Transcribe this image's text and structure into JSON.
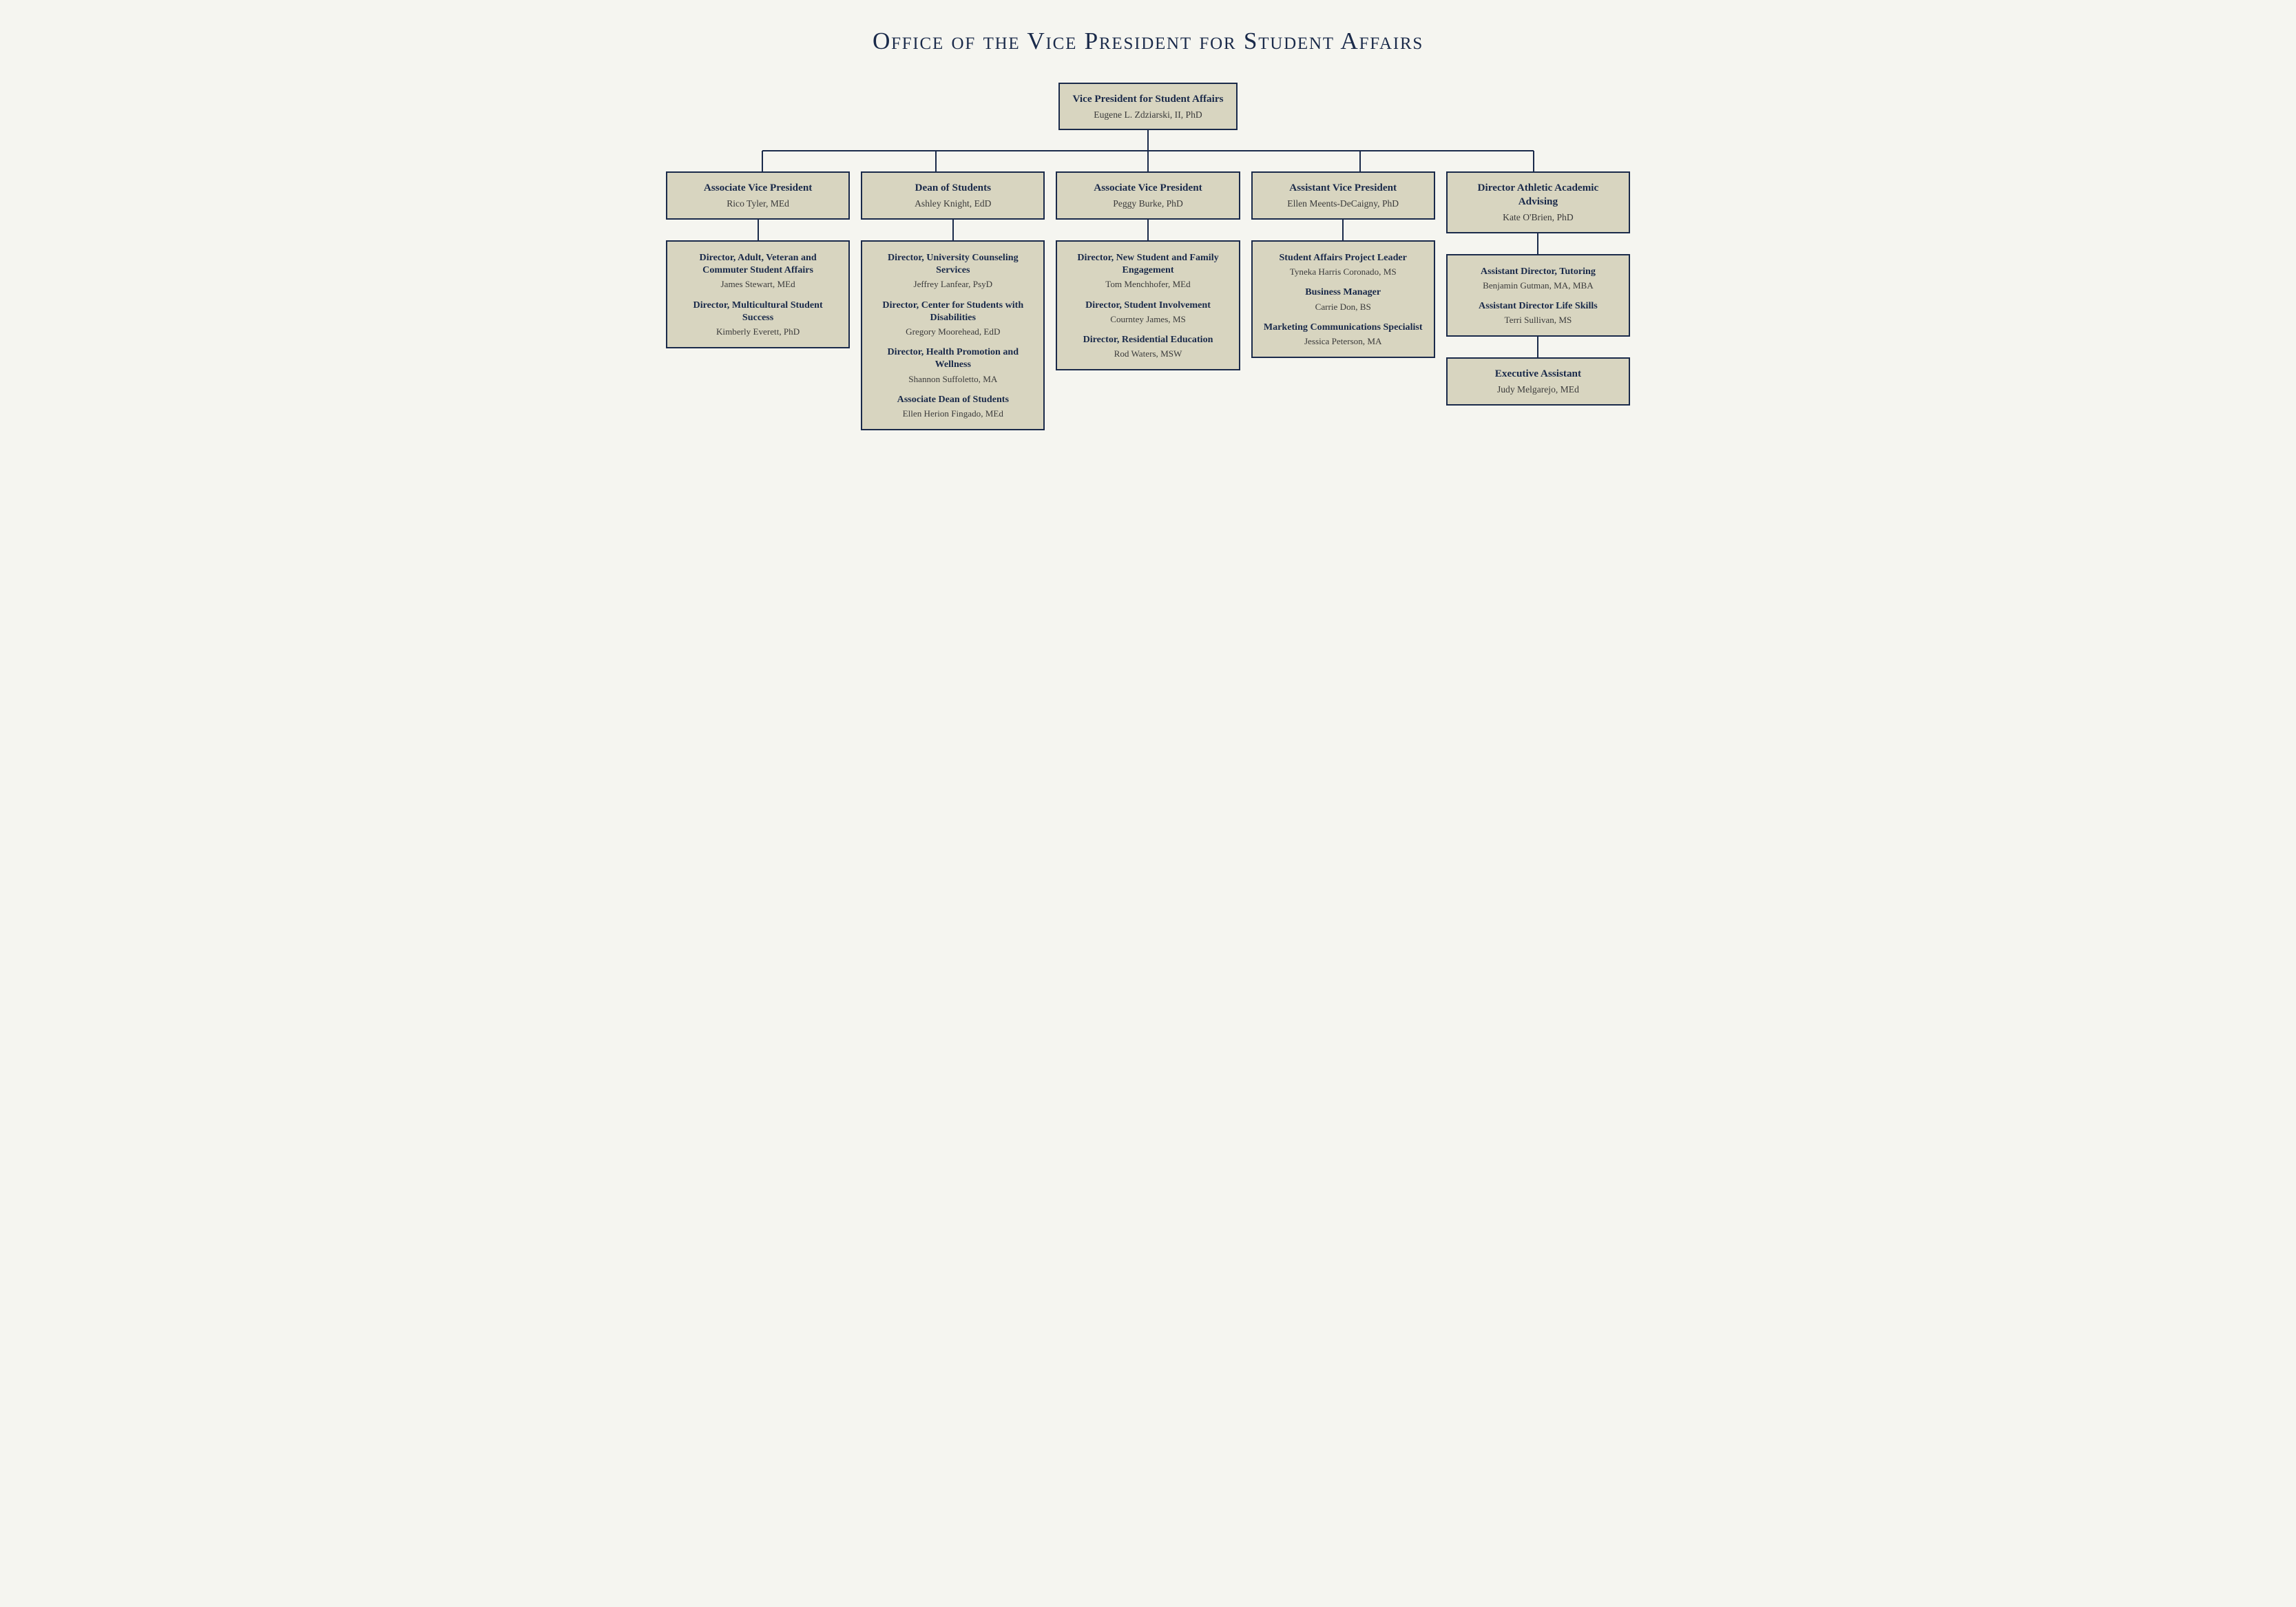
{
  "page": {
    "title": "Office of the Vice President for Student Affairs"
  },
  "vp": {
    "title": "Vice President for Student Affairs",
    "name": "Eugene L. Zdziarski, II, PhD"
  },
  "columns": [
    {
      "id": "col1",
      "level1": {
        "title": "Associate Vice President",
        "name": "Rico Tyler, MEd"
      },
      "level2": {
        "entries": [
          {
            "title": "Director, Adult, Veteran and Commuter Student Affairs",
            "name": "James Stewart, MEd"
          },
          {
            "title": "Director, Multicultural Student Success",
            "name": "Kimberly Everett, PhD"
          }
        ]
      }
    },
    {
      "id": "col2",
      "level1": {
        "title": "Dean of Students",
        "name": "Ashley Knight, EdD"
      },
      "level2": {
        "entries": [
          {
            "title": "Director, University Counseling Services",
            "name": "Jeffrey Lanfear, PsyD"
          },
          {
            "title": "Director, Center for Students with Disabilities",
            "name": "Gregory Moorehead, EdD"
          },
          {
            "title": "Director, Health Promotion and Wellness",
            "name": "Shannon Suffoletto, MA"
          },
          {
            "title": "Associate Dean of Students",
            "name": "Ellen Herion Fingado, MEd"
          }
        ]
      }
    },
    {
      "id": "col3",
      "level1": {
        "title": "Associate Vice President",
        "name": "Peggy Burke, PhD"
      },
      "level2": {
        "entries": [
          {
            "title": "Director, New Student and Family Engagement",
            "name": "Tom Menchhofer, MEd"
          },
          {
            "title": "Director, Student Involvement",
            "name": "Courntey James, MS"
          },
          {
            "title": "Director, Residential Education",
            "name": "Rod Waters, MSW"
          }
        ]
      }
    },
    {
      "id": "col4",
      "level1": {
        "title": "Assistant Vice President",
        "name": "Ellen Meents-DeCaigny, PhD"
      },
      "level2": {
        "entries": [
          {
            "title": "Student Affairs Project Leader",
            "name": "Tyneka Harris Coronado, MS"
          },
          {
            "title": "Business Manager",
            "name": "Carrie Don, BS"
          },
          {
            "title": "Marketing Communications Specialist",
            "name": "Jessica Peterson, MA"
          }
        ]
      }
    },
    {
      "id": "col5",
      "level1": {
        "title": "Director Athletic Academic Advising",
        "name": "Kate O'Brien, PhD"
      },
      "level2": {
        "entries": [
          {
            "title": "Assistant Director, Tutoring",
            "name": "Benjamin Gutman, MA, MBA"
          },
          {
            "title": "Assistant Director Life Skills",
            "name": "Terri Sullivan, MS"
          }
        ]
      },
      "level3": {
        "title": "Executive Assistant",
        "name": "Judy Melgarejo, MEd"
      }
    }
  ]
}
